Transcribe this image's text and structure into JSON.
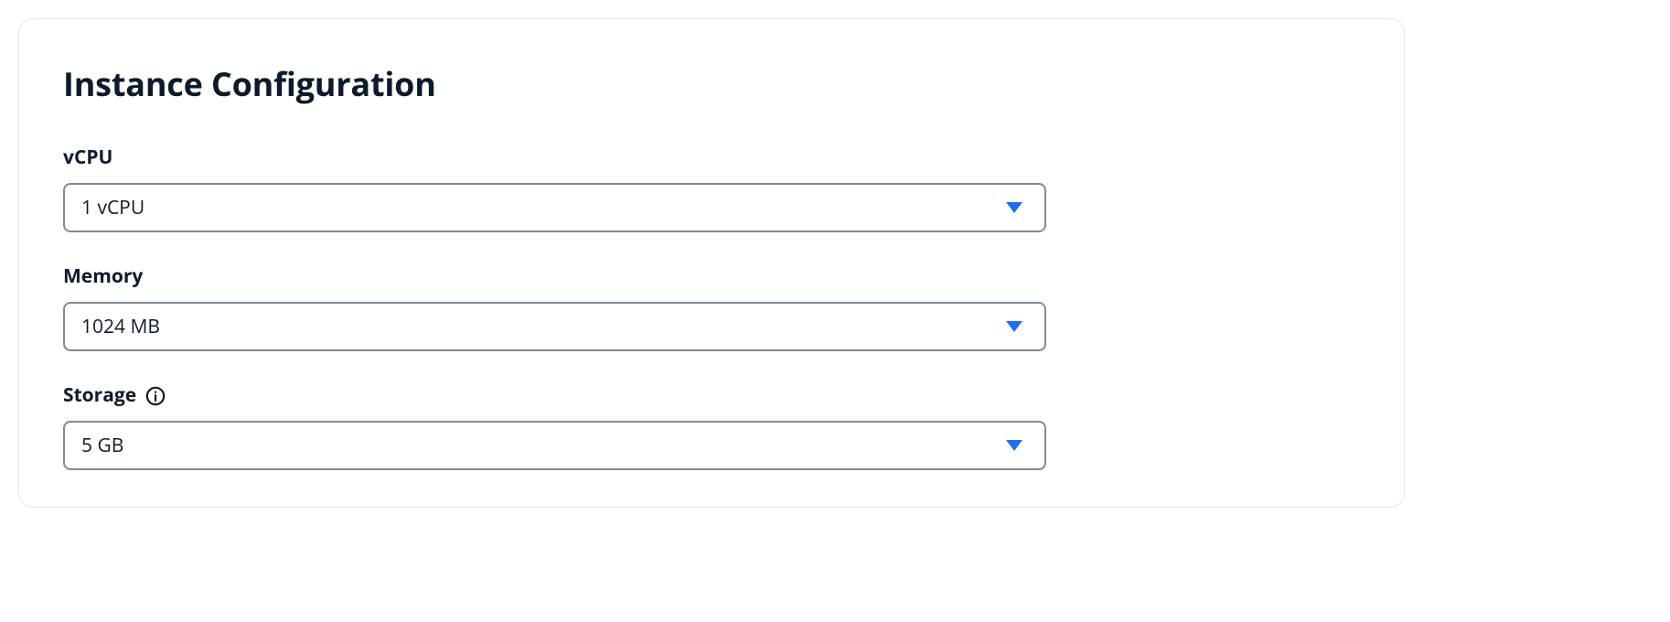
{
  "card": {
    "title": "Instance Configuration"
  },
  "fields": {
    "vcpu": {
      "label": "vCPU",
      "value": "1 vCPU"
    },
    "memory": {
      "label": "Memory",
      "value": "1024 MB"
    },
    "storage": {
      "label": "Storage",
      "value": "5 GB"
    }
  },
  "colors": {
    "accent": "#1f6feb",
    "border": "#7f8b96",
    "text": "#0d1b2a"
  }
}
